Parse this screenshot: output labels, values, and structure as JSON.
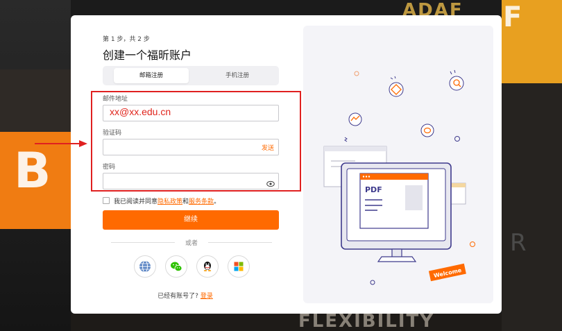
{
  "step_indicator": "第 1 步，共 2 步",
  "title": "创建一个福昕账户",
  "tabs": [
    {
      "label": "邮箱注册",
      "active": true
    },
    {
      "label": "手机注册",
      "active": false
    }
  ],
  "form": {
    "email_label": "邮件地址",
    "email_value": "xx@xx.edu.cn",
    "code_label": "验证码",
    "code_value": "",
    "send_label": "发送",
    "password_label": "密码",
    "password_value": ""
  },
  "agreement": {
    "prefix": "我已阅读并同意",
    "privacy": "隐私政策",
    "and": "和",
    "terms": "服务条款",
    "suffix": "。"
  },
  "continue_label": "继续",
  "or_label": "或者",
  "social_icons": [
    "globe-icon",
    "wechat-icon",
    "qq-icon",
    "microsoft-icon"
  ],
  "already_account": "已经有账号了?",
  "login_link": "登录",
  "illustration": {
    "pdf_label": "PDF",
    "welcome_label": "Welcome"
  },
  "colors": {
    "accent": "#ff6a00",
    "highlight": "#e02020",
    "illustration_line": "#3e3a8c"
  }
}
